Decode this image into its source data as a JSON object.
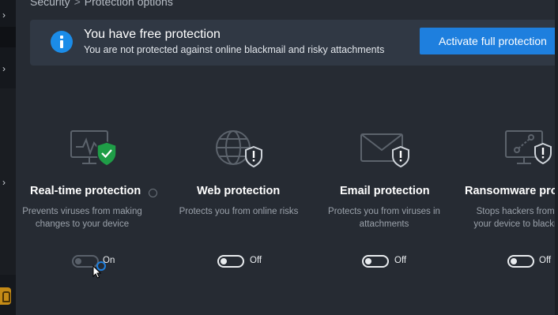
{
  "breadcrumb": {
    "items": [
      "Security",
      "Protection options"
    ],
    "separator": ">"
  },
  "banner": {
    "icon": "info-icon",
    "title": "You have free protection",
    "subtitle": "You are not protected against online blackmail and risky attachments",
    "button_label": "Activate full protection"
  },
  "cards": [
    {
      "icon": "monitor-check-icon",
      "title": "Real-time protection",
      "description": "Prevents viruses from making changes to your device",
      "toggle_label": "On",
      "toggle_on": true
    },
    {
      "icon": "globe-warning-icon",
      "title": "Web protection",
      "description": "Protects you from online risks",
      "toggle_label": "Off",
      "toggle_on": false
    },
    {
      "icon": "envelope-warning-icon",
      "title": "Email protection",
      "description": "Protects you from viruses in attachments",
      "toggle_label": "Off",
      "toggle_on": false
    },
    {
      "icon": "monitor-warning-icon",
      "title": "Ransomware prot",
      "description": "Stops hackers from l your device to blackm",
      "toggle_label": "Off",
      "toggle_on": false
    }
  ],
  "colors": {
    "background": "#262b33",
    "banner": "#303844",
    "accent": "#1e7fde",
    "success": "#1f9d47",
    "text_muted": "#9ba2ab"
  }
}
